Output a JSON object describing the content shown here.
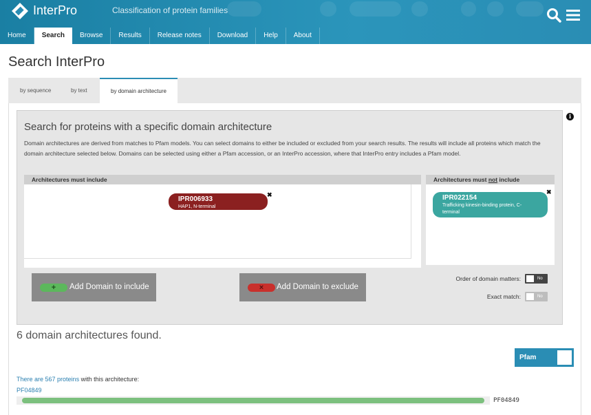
{
  "header": {
    "brand": "InterPro",
    "tagline": "Classification of protein families",
    "logo_icon": "interpro-logo-icon",
    "search_icon": "search-icon",
    "menu_icon": "menu-icon"
  },
  "nav": {
    "items": [
      "Home",
      "Search",
      "Browse",
      "Results",
      "Release notes",
      "Download",
      "Help",
      "About"
    ],
    "active": "Search"
  },
  "page": {
    "title": "Search InterPro"
  },
  "tabs": [
    {
      "label": "by sequence"
    },
    {
      "label": "by text"
    },
    {
      "label": "by domain architecture",
      "active": true
    }
  ],
  "ida": {
    "title": "Search for proteins with a specific domain architecture",
    "description": "Domain architectures are derived from matches to Pfam models. You can select domains to either be included or excluded from your search results. The results will include all proteins which match the domain architecture selected below. Domains can be selected using either a Pfam accession, or an InterPro accession, where that InterPro entry includes a Pfam model.",
    "include": {
      "header": "Architectures must include",
      "domains": [
        {
          "accession": "IPR006933",
          "name": "HAP1, N-terminal",
          "color": "#8b2020"
        }
      ],
      "add_label": "Add Domain to include",
      "add_symbol": "+",
      "add_color": "#5cb85c"
    },
    "exclude": {
      "header_pre": "Architectures must ",
      "header_emph": "not",
      "header_post": " include",
      "domains": [
        {
          "accession": "IPR022154",
          "name": "Trafficking kinesin-binding protein, C-terminal",
          "color": "#3ba6a0"
        }
      ],
      "add_label": "Add Domain to exclude",
      "add_symbol": "×",
      "add_color": "#c9302c"
    },
    "remove_symbol": "✖",
    "options": {
      "order_label": "Order of domain matters:",
      "order_value": "No",
      "exact_label": "Exact match:",
      "exact_value": "No"
    },
    "info_icon": "i"
  },
  "results": {
    "found_text": "6 domain architectures found.",
    "db_toggle": "Pfam",
    "items": [
      {
        "prefix": "There are ",
        "link": "567 proteins",
        "suffix": " with this architecture:",
        "accession": "PF04849",
        "track_label": "PF04849",
        "color": "#7cc07e"
      }
    ]
  }
}
